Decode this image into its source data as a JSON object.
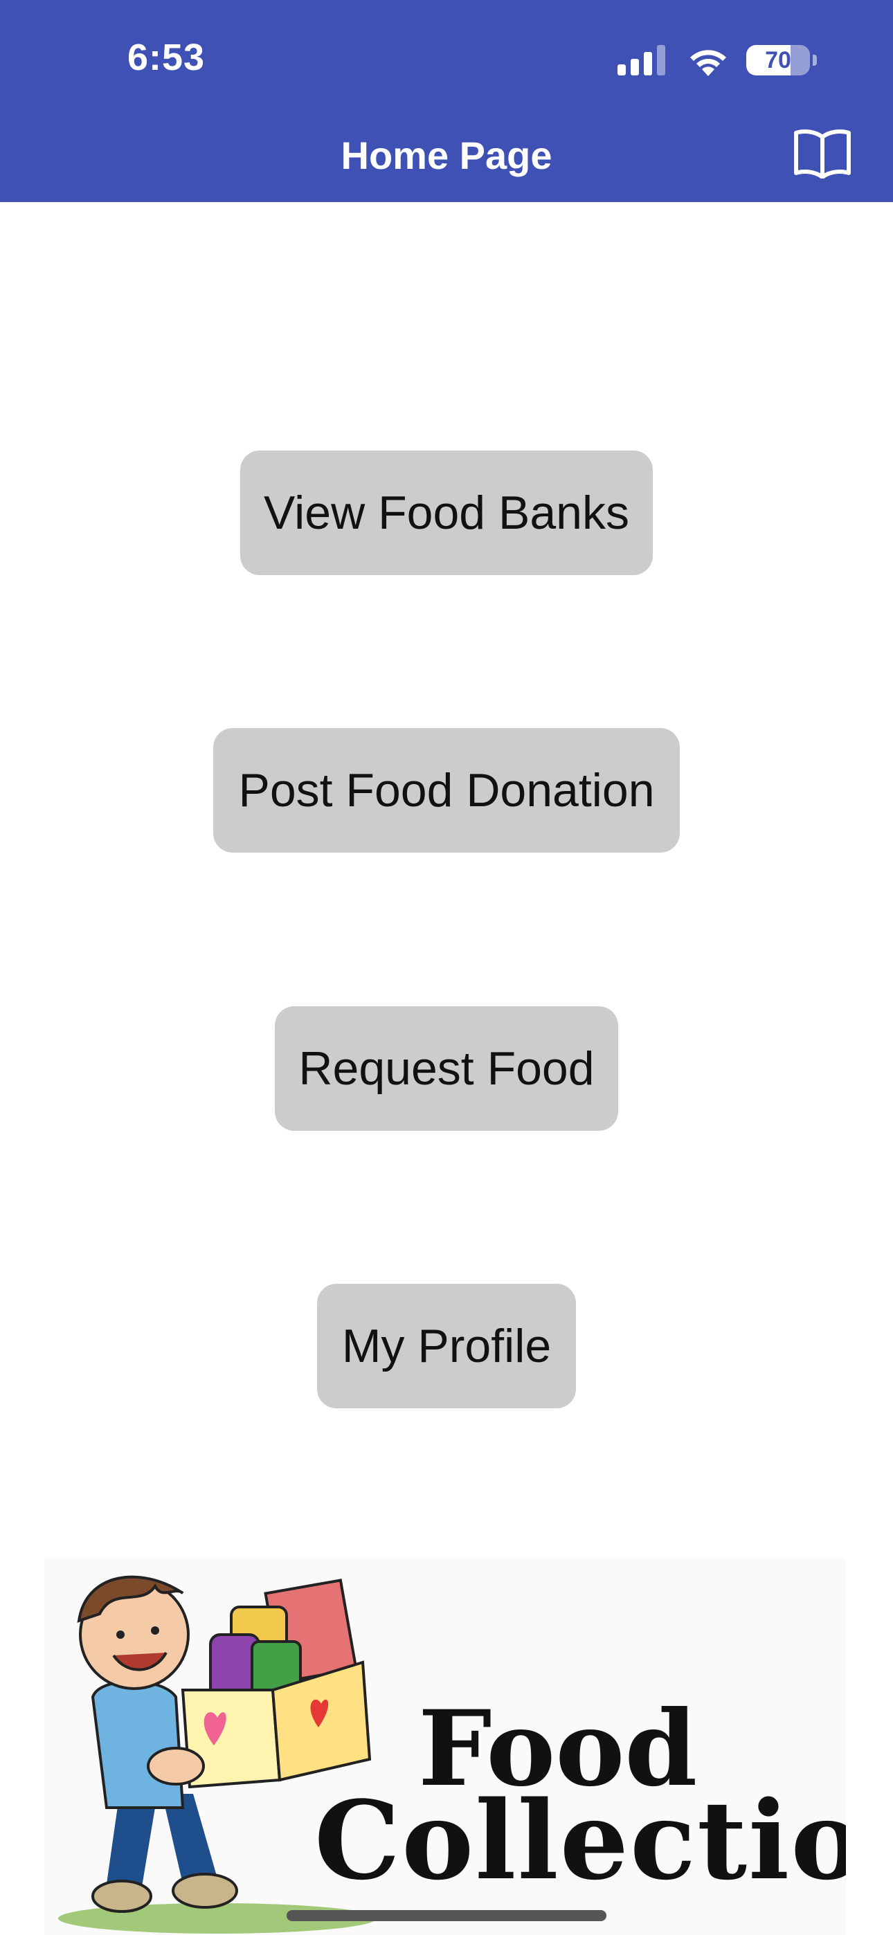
{
  "status_bar": {
    "time": "6:53",
    "battery_level": "70",
    "battery_fraction": 0.7,
    "signal_icon": "cellular-signal-icon",
    "wifi_icon": "wifi-icon"
  },
  "nav": {
    "title": "Home Page",
    "right_icon": "book-icon"
  },
  "buttons": [
    {
      "label": "View Food Banks"
    },
    {
      "label": "Post Food Donation"
    },
    {
      "label": "Request Food"
    },
    {
      "label": "My Profile"
    }
  ],
  "banner": {
    "line1": "Food",
    "line2": "Collection"
  },
  "colors": {
    "header": "#3f51b5",
    "button_bg": "#cccccc",
    "background": "#ffffff"
  }
}
